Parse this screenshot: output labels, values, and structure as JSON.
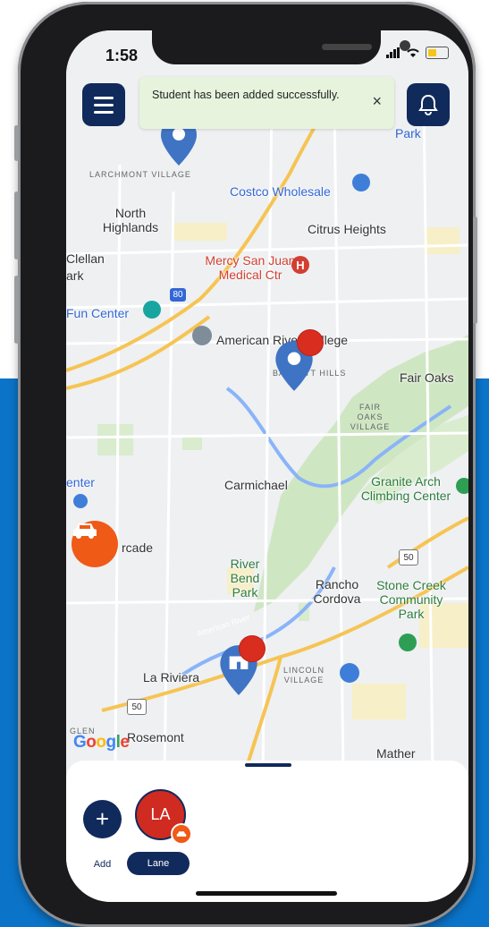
{
  "status_bar": {
    "time": "1:58"
  },
  "header": {
    "menu_icon": "hamburger-menu-icon",
    "bell_icon": "bell-icon"
  },
  "toast": {
    "message": "Student has been added successfully.",
    "close_symbol": "×"
  },
  "map": {
    "labels": {
      "park_top": "Park",
      "larchmont": "LARCHMONT VILLAGE",
      "costco": "Costco Wholesale",
      "north_highlands": "North Highlands",
      "citrus_heights": "Citrus Heights",
      "mcclellan": "Clellan",
      "ark": "ark",
      "mercy": "Mercy San Juan Medical Ctr",
      "fun_center": "Fun Center",
      "highway_80": "80",
      "american_river_college": "American River College",
      "barrett": "BARRETT HILLS",
      "fair_oaks": "Fair Oaks",
      "fair_oaks_village": "FAIR OAKS VILLAGE",
      "enter": "enter",
      "carmichael": "Carmichael",
      "granite_arch": "Granite Arch Climbing Center",
      "arcade": "rcade",
      "highway_50_right": "50",
      "river_bend_park": "River Bend Park",
      "rancho_cordova": "Rancho Cordova",
      "stone_creek": "Stone Creek Community Park",
      "american_river": "American River",
      "la_riviera": "La Riviera",
      "lincoln_village": "LINCOLN VILLAGE",
      "highway_50_left": "50",
      "glen": "GLEN",
      "rosemont": "Rosemont",
      "mather": "Mather"
    },
    "google_logo": "Google"
  },
  "bottom_sheet": {
    "add_symbol": "+",
    "add_label": "Add",
    "students": [
      {
        "initials": "LA",
        "name": "Lane"
      }
    ]
  },
  "colors": {
    "navy": "#112a5c",
    "marker_red": "#d92d20",
    "car_orange": "#ef5a17",
    "toast_bg": "#e7f3dd",
    "backdrop_blue": "#0b74c9"
  }
}
